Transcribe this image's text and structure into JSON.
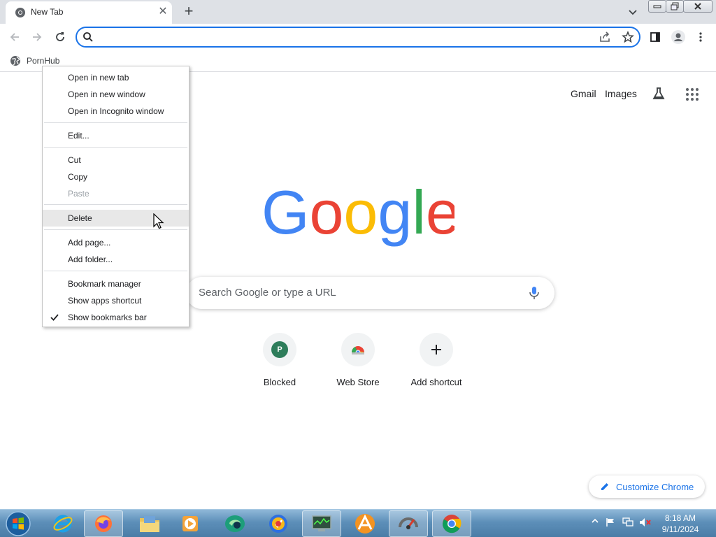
{
  "tabs": [
    {
      "title": "New Tab",
      "close_glyph": "✕"
    }
  ],
  "new_tab_glyph": "+",
  "omnibox": {
    "value": "",
    "placeholder": ""
  },
  "bookmarks_bar": {
    "items": [
      {
        "label": "PornHub",
        "icon": "globe-icon"
      }
    ]
  },
  "ntp": {
    "links": {
      "gmail": "Gmail",
      "images": "Images"
    },
    "logo_text": "Google",
    "search_placeholder": "Search Google or type a URL",
    "shortcuts": [
      {
        "label": "Blocked",
        "avatar_letter": "P"
      },
      {
        "label": "Web Store"
      },
      {
        "label": "Add shortcut",
        "glyph": "+"
      }
    ],
    "customize_label": "Customize Chrome"
  },
  "context_menu": {
    "items": [
      {
        "label": "Open in new tab"
      },
      {
        "label": "Open in new window"
      },
      {
        "label": "Open in Incognito window"
      },
      {
        "label": "Edit..."
      },
      {
        "label": "Cut"
      },
      {
        "label": "Copy"
      },
      {
        "label": "Paste",
        "disabled": true
      },
      {
        "label": "Delete",
        "highlighted": true
      },
      {
        "label": "Add page..."
      },
      {
        "label": "Add folder..."
      },
      {
        "label": "Bookmark manager"
      },
      {
        "label": "Show apps shortcut"
      },
      {
        "label": "Show bookmarks bar",
        "checked": true
      }
    ]
  },
  "taskbar": {
    "apps": [
      "internet-explorer",
      "firefox",
      "file-explorer",
      "media-player",
      "browser-app",
      "security-app",
      "task-manager",
      "app-orange",
      "app-gray",
      "chrome"
    ],
    "clock": {
      "time": "8:18 AM",
      "date": "9/11/2024"
    }
  },
  "colors": {
    "accent": "#1a73e8",
    "tabstrip": "#dee1e6",
    "taskbar": "#5d8fb9"
  }
}
